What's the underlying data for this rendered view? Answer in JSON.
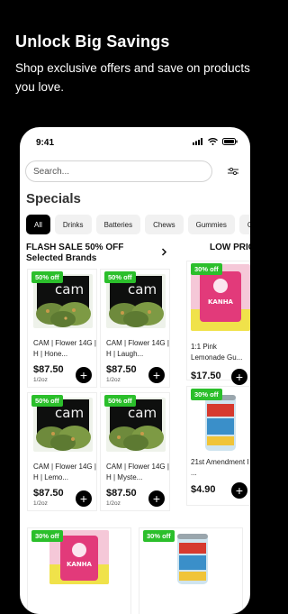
{
  "promo": {
    "title": "Unlock Big Savings",
    "subtitle": "Shop exclusive offers and save on products you love."
  },
  "status_bar": {
    "time": "9:41"
  },
  "search": {
    "placeholder": "Search..."
  },
  "specials": {
    "title": "Specials"
  },
  "categories": [
    "All",
    "Drinks",
    "Batteries",
    "Chews",
    "Gummies",
    "C"
  ],
  "deal_sections": [
    {
      "title_line1": "FLASH SALE 50% OFF",
      "title_line2": "Selected Brands"
    },
    {
      "title_line1": "LOW PRICES E"
    }
  ],
  "flash_products": [
    {
      "badge": "50% off",
      "name": "CAM | Flower 14G | H | Hone...",
      "price": "$87.50",
      "unit": "1/2oz"
    },
    {
      "badge": "50% off",
      "name": "CAM | Flower 14G | H | Laugh...",
      "price": "$87.50",
      "unit": "1/2oz"
    },
    {
      "badge": "50% off",
      "name": "CAM | Flower 14G | H | Lemo...",
      "price": "$87.50",
      "unit": "1/2oz"
    },
    {
      "badge": "50% off",
      "name": "CAM | Flower 14G | H | Myste...",
      "price": "$87.50",
      "unit": "1/2oz"
    }
  ],
  "low_price_products": [
    {
      "badge": "30% off",
      "name": "1:1 Pink Lemonade Gu...",
      "price": "$17.50"
    },
    {
      "badge": "30% off",
      "name": "21st Amendment I ...",
      "price": "$4.90"
    }
  ],
  "bottom_products": [
    {
      "badge": "30% off"
    },
    {
      "badge": "30% off"
    }
  ],
  "product_image_brand": "cam",
  "gummy_label": "KANHA",
  "colors": {
    "badge_green": "#2bbf2b",
    "active_chip": "#000000",
    "background": "#000000"
  }
}
